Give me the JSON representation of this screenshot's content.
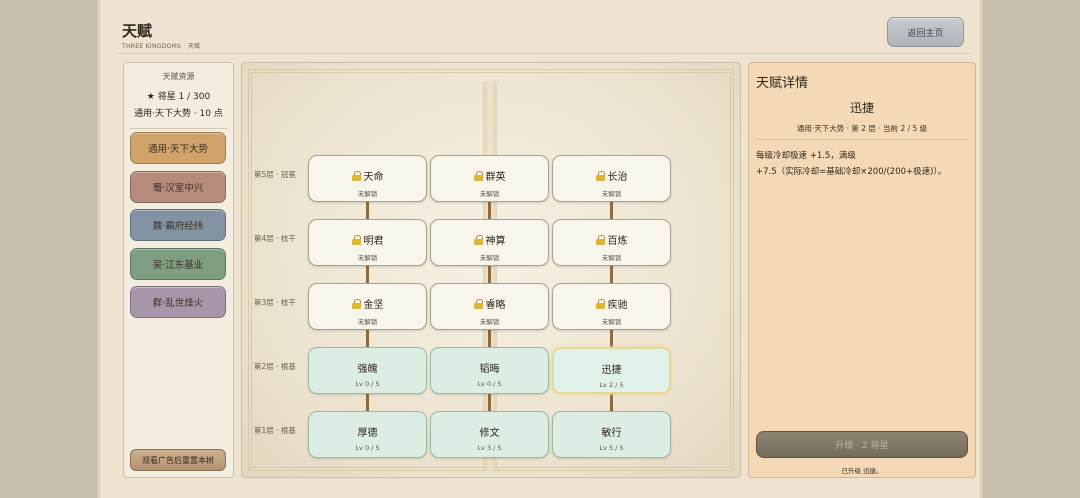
{
  "header": {
    "title": "天赋",
    "subtitle": "THREE KINGDOMS · 天赋",
    "back_label": "返回主页"
  },
  "sidebar": {
    "title": "天赋资源",
    "stars": "★ 将星 1 / 300",
    "points": "通用·天下大势 · 10 点",
    "factions": [
      {
        "label": "通用·天下大势",
        "color": "#cfa36a"
      },
      {
        "label": "蜀·汉室中兴",
        "color": "#b58b7c"
      },
      {
        "label": "魏·霸府经纬",
        "color": "#8493a4"
      },
      {
        "label": "吴·江东基业",
        "color": "#7f9d80"
      },
      {
        "label": "群·乱世烽火",
        "color": "#a796aa"
      }
    ],
    "reset_label": "观看广告后重置本树"
  },
  "tree": {
    "tiers": [
      {
        "label": "第5层 · 冠冕",
        "nodes": [
          {
            "name": "天命",
            "status": "未解锁",
            "locked": true
          },
          {
            "name": "群英",
            "status": "未解锁",
            "locked": true
          },
          {
            "name": "长治",
            "status": "未解锁",
            "locked": true
          }
        ]
      },
      {
        "label": "第4层 · 枝干",
        "nodes": [
          {
            "name": "明君",
            "status": "未解锁",
            "locked": true
          },
          {
            "name": "神算",
            "status": "未解锁",
            "locked": true
          },
          {
            "name": "百炼",
            "status": "未解锁",
            "locked": true
          }
        ]
      },
      {
        "label": "第3层 · 枝干",
        "nodes": [
          {
            "name": "金坚",
            "status": "未解锁",
            "locked": true
          },
          {
            "name": "睿略",
            "status": "未解锁",
            "locked": true
          },
          {
            "name": "疾驰",
            "status": "未解锁",
            "locked": true
          }
        ]
      },
      {
        "label": "第2层 · 根基",
        "nodes": [
          {
            "name": "强魄",
            "status": "Lv 0 / 5",
            "locked": false
          },
          {
            "name": "韬晦",
            "status": "Lv 0 / 5",
            "locked": false
          },
          {
            "name": "迅捷",
            "status": "Lv 2 / 5",
            "locked": false
          }
        ]
      },
      {
        "label": "第1层 · 根基",
        "nodes": [
          {
            "name": "厚德",
            "status": "Lv 0 / 5",
            "locked": false
          },
          {
            "name": "修文",
            "status": "Lv 3 / 5",
            "locked": false
          },
          {
            "name": "敏行",
            "status": "Lv 5 / 5",
            "locked": false
          }
        ]
      }
    ]
  },
  "detail": {
    "title": "天赋详情",
    "name": "迅捷",
    "meta": "通用·天下大势 · 第 2 层 · 当前 2 / 5 级",
    "desc_line1": "每级冷却极速 +1.5，满级",
    "desc_line2": "+7.5（实际冷却=基础冷却×200/(200+极速)）。",
    "upgrade_label": "升级 · 2 将星",
    "note": "已升级 迅捷。"
  }
}
